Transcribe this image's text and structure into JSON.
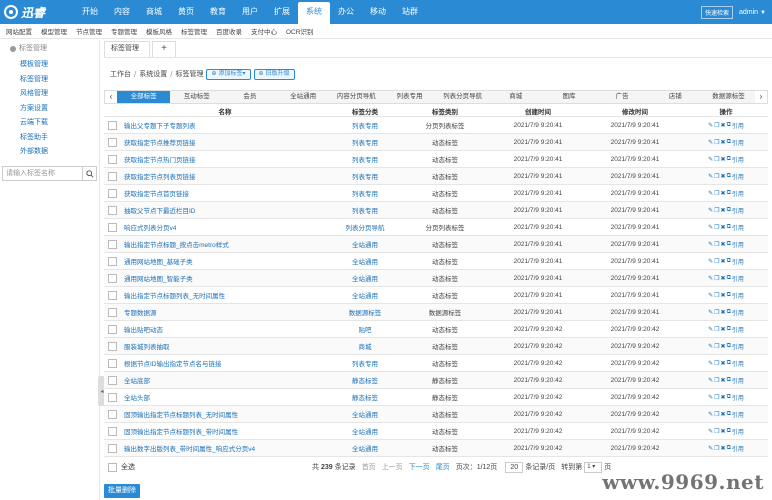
{
  "header": {
    "logo_text": "迅睿",
    "nav": [
      "开始",
      "内容",
      "商城",
      "黄页",
      "教育",
      "用户",
      "扩展",
      "系统",
      "办公",
      "移动",
      "站群"
    ],
    "active_nav_index": 7,
    "quick_search": "快速检索",
    "user": "admin"
  },
  "subnav": [
    "网站配置",
    "模型管理",
    "节点管理",
    "专题管理",
    "模板风格",
    "标签管理",
    "百度收录",
    "支付中心",
    "OCR识别"
  ],
  "sidebar": {
    "title": "标签管理",
    "items": [
      "模板管理",
      "标签管理",
      "风格管理",
      "方案设置",
      "云端下载",
      "标签助手",
      "外部数据"
    ],
    "search_placeholder": "请输入标签名称"
  },
  "tabs": {
    "page_tab": "标签管理",
    "add_tab": "+"
  },
  "breadcrumb": {
    "items": [
      "工作台",
      "系统设置",
      "标签管理"
    ],
    "sep": "/",
    "add_btn": "添加标签",
    "sync_btn": "旧版升级"
  },
  "categories": {
    "items": [
      "全部标签",
      "互动标签",
      "会员",
      "全站通用",
      "内容分页导航",
      "列表专用",
      "列表分页导航",
      "商城",
      "图库",
      "广告",
      "店铺",
      "数据源标签"
    ],
    "active_index": 0,
    "prev": "‹",
    "next": "›"
  },
  "table": {
    "headers": [
      "名称",
      "标签分类",
      "标签类别",
      "创建时间",
      "修改时间",
      "操作"
    ],
    "op_text": "引用",
    "rows": [
      {
        "name": "输出父专题下子专题列表",
        "class": "列表专用",
        "type": "分页列表标签",
        "created": "2021/7/9 9:20:41",
        "modified": "2021/7/9 9:20:41"
      },
      {
        "name": "获取指定节点推荐页链接",
        "class": "列表专用",
        "type": "动态标签",
        "created": "2021/7/9 9:20:41",
        "modified": "2021/7/9 9:20:41"
      },
      {
        "name": "获取指定节点热门页链接",
        "class": "列表专用",
        "type": "动态标签",
        "created": "2021/7/9 9:20:41",
        "modified": "2021/7/9 9:20:41"
      },
      {
        "name": "获取指定节点列表页链接",
        "class": "列表专用",
        "type": "动态标签",
        "created": "2021/7/9 9:20:41",
        "modified": "2021/7/9 9:20:41"
      },
      {
        "name": "获取指定节点首页链接",
        "class": "列表专用",
        "type": "动态标签",
        "created": "2021/7/9 9:20:41",
        "modified": "2021/7/9 9:20:41"
      },
      {
        "name": "抽取父节点下最近栏目ID",
        "class": "列表专用",
        "type": "动态标签",
        "created": "2021/7/9 9:20:41",
        "modified": "2021/7/9 9:20:41"
      },
      {
        "name": "响应式列表分页v4",
        "class": "列表分页导航",
        "type": "分页列表标签",
        "created": "2021/7/9 9:20:41",
        "modified": "2021/7/9 9:20:41"
      },
      {
        "name": "输出指定节点标题_按点击metro样式",
        "class": "全站通用",
        "type": "动态标签",
        "created": "2021/7/9 9:20:41",
        "modified": "2021/7/9 9:20:41"
      },
      {
        "name": "通用网站地图_基础子类",
        "class": "全站通用",
        "type": "动态标签",
        "created": "2021/7/9 9:20:41",
        "modified": "2021/7/9 9:20:41"
      },
      {
        "name": "通用网站地图_智能子类",
        "class": "全站通用",
        "type": "动态标签",
        "created": "2021/7/9 9:20:41",
        "modified": "2021/7/9 9:20:41"
      },
      {
        "name": "输出指定节点标题列表_无时间属性",
        "class": "全站通用",
        "type": "动态标签",
        "created": "2021/7/9 9:20:41",
        "modified": "2021/7/9 9:20:41"
      },
      {
        "name": "专题数据源",
        "class": "数据源标签",
        "type": "数据源标签",
        "created": "2021/7/9 9:20:41",
        "modified": "2021/7/9 9:20:41"
      },
      {
        "name": "输出贴吧动态",
        "class": "贴吧",
        "type": "动态标签",
        "created": "2021/7/9 9:20:42",
        "modified": "2021/7/9 9:20:42"
      },
      {
        "name": "服装城列表抽取",
        "class": "商城",
        "type": "动态标签",
        "created": "2021/7/9 9:20:42",
        "modified": "2021/7/9 9:20:42"
      },
      {
        "name": "根据节点ID输出指定节点名与链接",
        "class": "列表专用",
        "type": "动态标签",
        "created": "2021/7/9 9:20:42",
        "modified": "2021/7/9 9:20:42"
      },
      {
        "name": "全站底部",
        "class": "静态标签",
        "type": "静态标签",
        "created": "2021/7/9 9:20:42",
        "modified": "2021/7/9 9:20:42"
      },
      {
        "name": "全站头部",
        "class": "静态标签",
        "type": "静态标签",
        "created": "2021/7/9 9:20:42",
        "modified": "2021/7/9 9:20:42"
      },
      {
        "name": "固顶输出指定节点标题列表_无时间属性",
        "class": "全站通用",
        "type": "动态标签",
        "created": "2021/7/9 9:20:42",
        "modified": "2021/7/9 9:20:42"
      },
      {
        "name": "固顶输出指定节点标题列表_带时间属性",
        "class": "全站通用",
        "type": "动态标签",
        "created": "2021/7/9 9:20:42",
        "modified": "2021/7/9 9:20:42"
      },
      {
        "name": "输出数字出版列表_带时间属性_响应式分页v4",
        "class": "全站通用",
        "type": "动态标签",
        "created": "2021/7/9 9:20:42",
        "modified": "2021/7/9 9:20:42"
      }
    ]
  },
  "footer": {
    "select_all": "全选",
    "total_prefix": "共",
    "total": "239",
    "total_suffix": "条记录",
    "first": "首页",
    "prev": "上一页",
    "next": "下一页",
    "last": "尾页",
    "page_label": "页次：",
    "page_info": "1/12页",
    "per_page": "20",
    "per_page_suffix": "条记录/页",
    "goto_label": "转到第",
    "goto_value": "1",
    "goto_suffix": "页",
    "batch_delete": "批量删除"
  },
  "watermark": "www.9969.net",
  "colors": {
    "primary": "#2a8ad4",
    "link": "#1a6fb8"
  }
}
